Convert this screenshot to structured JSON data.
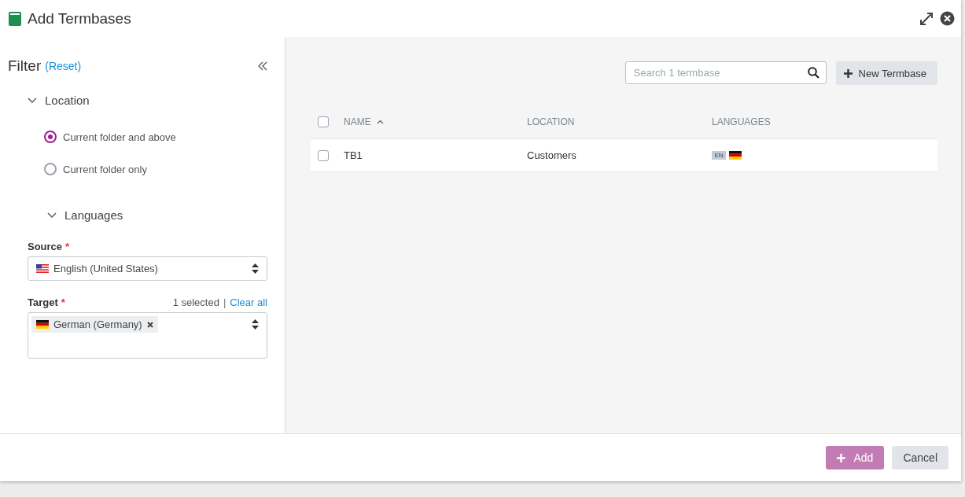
{
  "window": {
    "title": "Add Termbases"
  },
  "filter": {
    "title": "Filter",
    "reset": "(Reset)",
    "location": {
      "title": "Location",
      "expanded": true,
      "options": [
        {
          "label": "Current folder and above",
          "selected": true
        },
        {
          "label": "Current folder only",
          "selected": false
        }
      ]
    },
    "languages": {
      "title": "Languages",
      "expanded": true,
      "source": {
        "label": "Source",
        "required_mark": "*",
        "value": "English (United States)"
      },
      "target": {
        "label": "Target",
        "required_mark": "*",
        "count": "1 selected",
        "separator": "|",
        "clear": "Clear all",
        "chips": [
          {
            "label": "German (Germany)"
          }
        ]
      }
    }
  },
  "table": {
    "search": {
      "placeholder": "Search 1 termbase"
    },
    "new_button": "New Termbase",
    "all_checked": false,
    "columns": [
      {
        "label": "NAME",
        "sorted_ascending": true
      },
      {
        "label": "LOCATION",
        "sorted_ascending": false
      },
      {
        "label": "LANGUAGES",
        "sorted_ascending": false
      }
    ],
    "rows": [
      {
        "checked": false,
        "name": "TB1",
        "location": "Customers",
        "source_badge": "EN"
      }
    ]
  },
  "buttons": [
    {
      "label": "Add",
      "kind": "primary",
      "disabled": true
    },
    {
      "label": "Cancel",
      "kind": "secondary",
      "disabled": false
    }
  ]
}
